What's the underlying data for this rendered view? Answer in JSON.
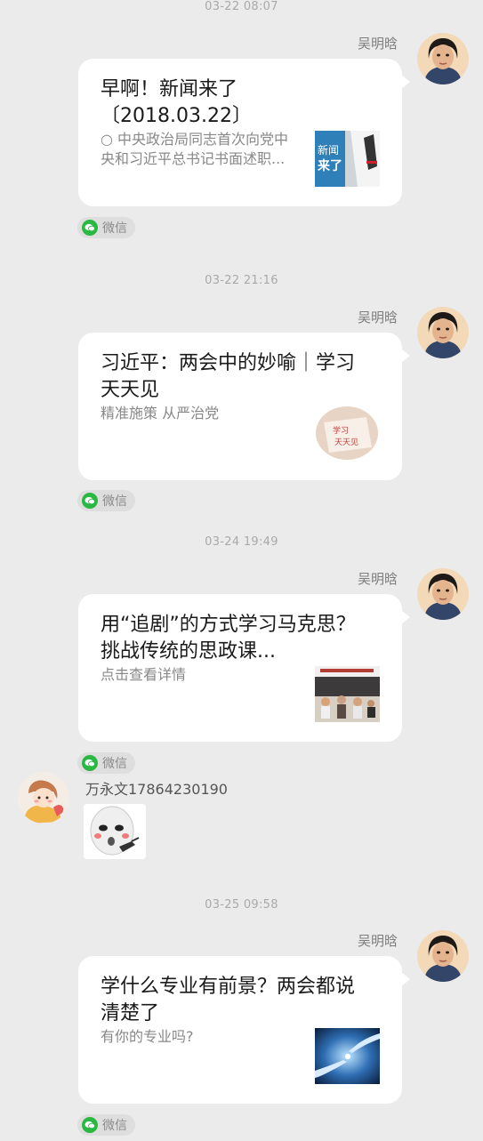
{
  "messages": [
    {
      "timestamp": "03-22 08:07",
      "sender": "吴明晗",
      "title": "早啊！新闻来了〔2018.03.22〕",
      "description": "○ 中央政治局同志首次向党中央和习近平总书记书面述职...",
      "thumb_label_1": "新闻",
      "thumb_label_2": "来了",
      "source": "微信"
    },
    {
      "timestamp": "03-22 21:16",
      "sender": "吴明晗",
      "title": "习近平：两会中的妙喻｜学习天天见",
      "description": "精准施策 从严治党",
      "thumb_label_1": "学习",
      "thumb_label_2": "天天见",
      "source": "微信"
    },
    {
      "timestamp": "03-24 19:49",
      "sender": "吴明晗",
      "title": "用“追剧”的方式学习马克思？挑战传统的思政课...",
      "description": "点击查看详情",
      "source": "微信"
    },
    {
      "sender": "万永文17864230190",
      "type": "sticker"
    },
    {
      "timestamp": "03-25 09:58",
      "sender": "吴明晗",
      "title": "学什么专业有前景？两会都说清楚了",
      "description": "有你的专业吗?",
      "source": "微信"
    }
  ],
  "colors": {
    "background": "#ebebeb",
    "card": "#ffffff",
    "wechat_green": "#2ab843"
  },
  "icons": {
    "source_icon": "wechat-icon",
    "avatar_right": "avatar-woman",
    "avatar_left": "avatar-cartoon"
  }
}
